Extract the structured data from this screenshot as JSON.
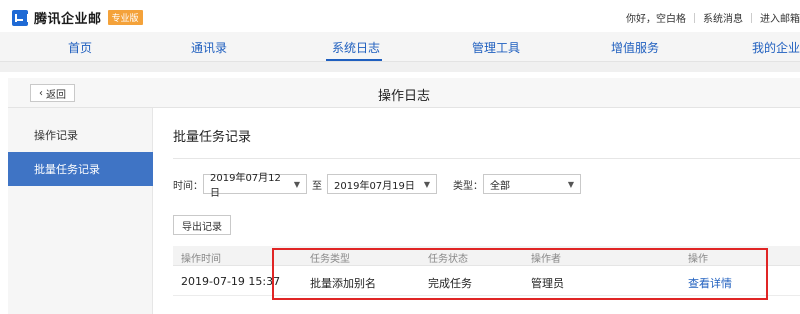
{
  "app": {
    "name": "腾讯企业邮",
    "edition_badge": "专业版"
  },
  "top_right": {
    "greeting": "你好，空白格",
    "system_message": "系统消息",
    "enter_mail": "进入邮箱"
  },
  "nav": {
    "items": [
      "首页",
      "通讯录",
      "系统日志",
      "管理工具",
      "增值服务",
      "我的企业"
    ],
    "active": "系统日志"
  },
  "header": {
    "back_label": "返回",
    "title": "操作日志"
  },
  "sidebar": {
    "items": [
      {
        "label": "操作记录",
        "active": false
      },
      {
        "label": "批量任务记录",
        "active": true
      }
    ]
  },
  "main": {
    "section_title": "批量任务记录",
    "filters": {
      "time_label": "时间：",
      "start_date": "2019年07月12日",
      "to_label": "至",
      "end_date": "2019年07月19日",
      "type_label": "类型：",
      "type_value": "全部"
    },
    "export_label": "导出记录",
    "table": {
      "headers": [
        "操作时间",
        "任务类型",
        "任务状态",
        "操作者",
        "操作"
      ],
      "rows": [
        {
          "time": "2019-07-19 15:37",
          "type": "批量添加别名",
          "status": "完成任务",
          "operator": "管理员",
          "action": "查看详情"
        }
      ]
    }
  },
  "colors": {
    "brand_blue": "#1f6ad5",
    "link_blue": "#1f5fbf",
    "active_side": "#3f74c5",
    "badge_orange": "#f4a23a",
    "highlight_red": "#e02525"
  }
}
